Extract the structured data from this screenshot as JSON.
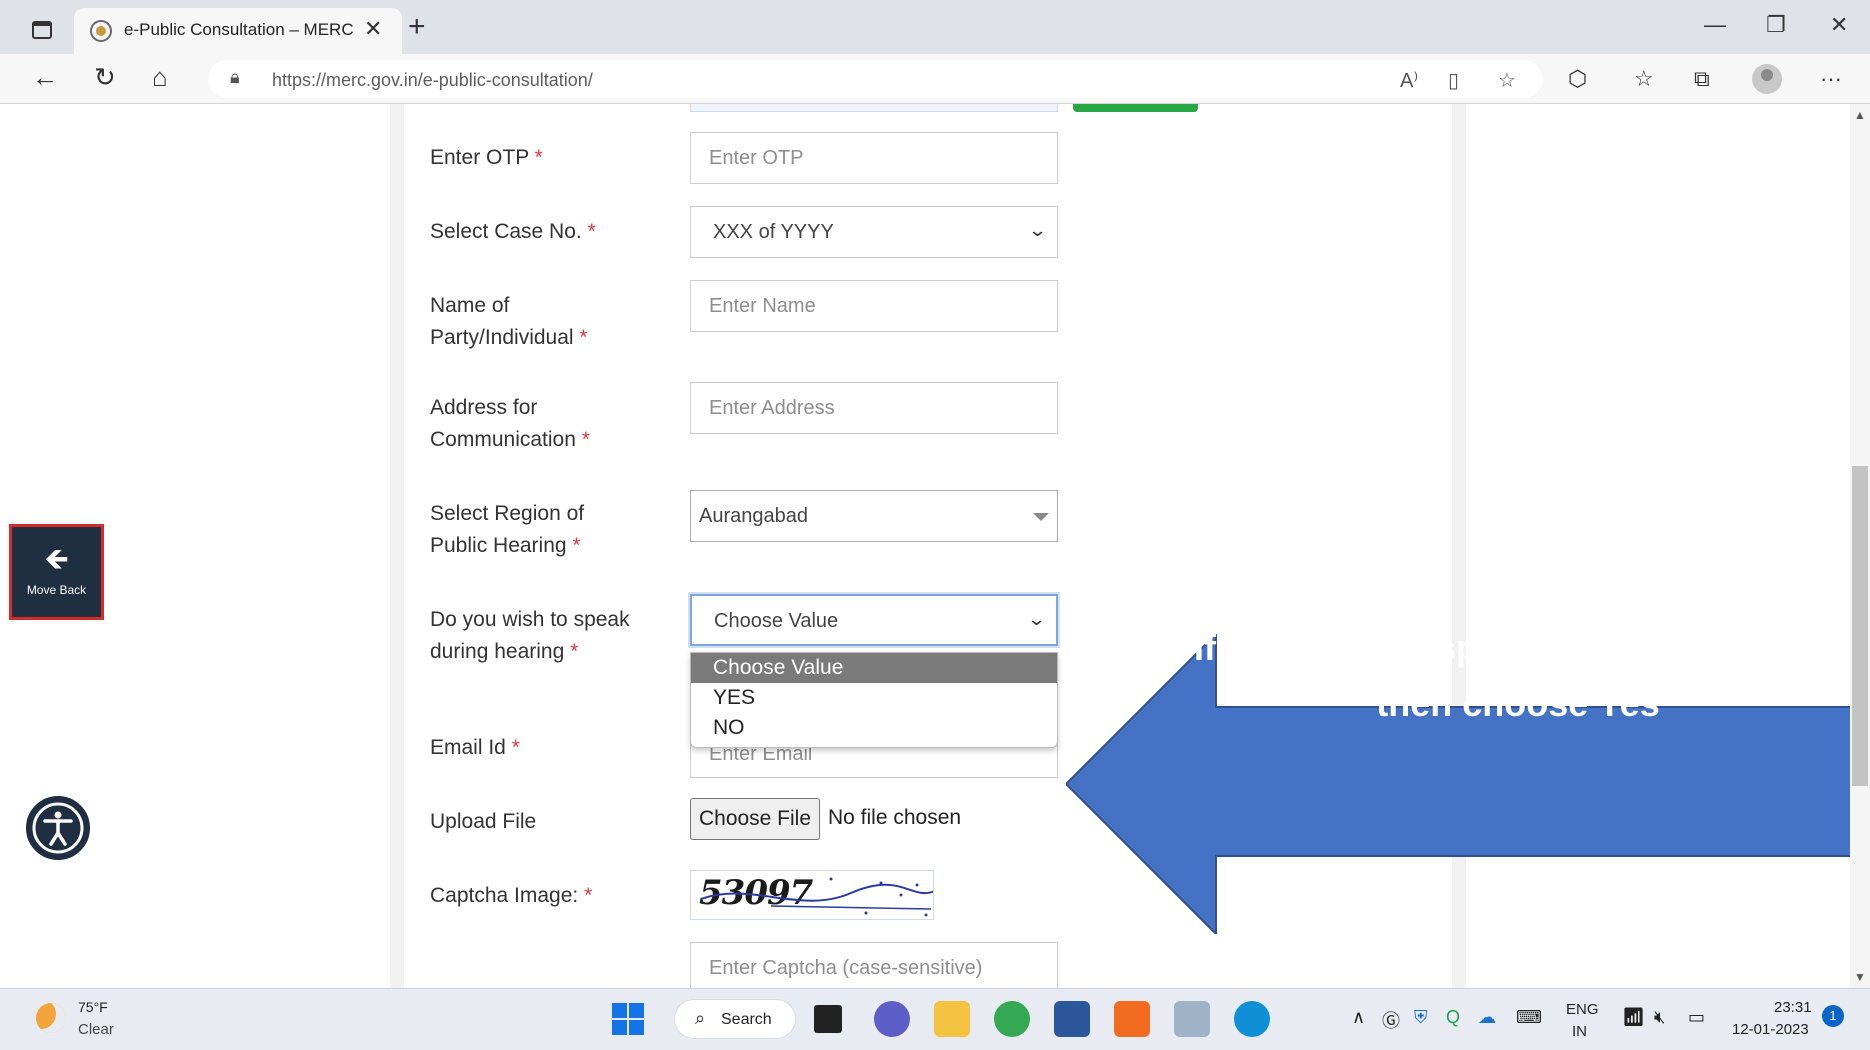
{
  "browser": {
    "tab_title": "e-Public Consultation – MERC",
    "tab_close": "✕",
    "new_tab": "+",
    "url": "https://merc.gov.in/e-public-consultation/",
    "window_controls": {
      "minimize": "—",
      "restore": "❐",
      "close": "✕"
    },
    "more_menu": "···"
  },
  "form": {
    "otp": {
      "label": "Enter OTP",
      "placeholder": "Enter OTP"
    },
    "case_no": {
      "label": "Select Case No.",
      "value": "XXX of YYYY"
    },
    "party": {
      "label_line1": "Name of",
      "label_line2": "Party/Individual",
      "placeholder": "Enter Name"
    },
    "address": {
      "label_line1": "Address for",
      "label_line2": "Communication",
      "placeholder": "Enter Address"
    },
    "region": {
      "label_line1": "Select Region of",
      "label_line2": "Public Hearing",
      "value": "Aurangabad"
    },
    "speak": {
      "label_line1": "Do you wish to speak",
      "label_line2": "during hearing",
      "value": "Choose Value",
      "options": [
        "Choose Value",
        "YES",
        "NO"
      ],
      "highlighted_option": "Choose Value"
    },
    "email": {
      "label": "Email Id",
      "placeholder": "Enter Email"
    },
    "upload": {
      "label": "Upload File",
      "button": "Choose File",
      "status": "No file chosen"
    },
    "captcha": {
      "label": "Captcha Image:",
      "image_text": "53097",
      "placeholder": "Enter Captcha (case-sensitive)"
    },
    "required_marker": "*"
  },
  "widgets": {
    "move_back": "Move Back",
    "move_back_arrow": "🡸"
  },
  "callout": {
    "line1": "If you want to speak during e-hearing,",
    "line2": "then choose Yes",
    "color": "#4472c4"
  },
  "taskbar": {
    "weather_temp": "75°F",
    "weather_cond": "Clear",
    "search_label": "Search",
    "language_line1": "ENG",
    "language_line2": "IN",
    "time": "23:31",
    "date": "12-01-2023",
    "notification_count": "1"
  }
}
